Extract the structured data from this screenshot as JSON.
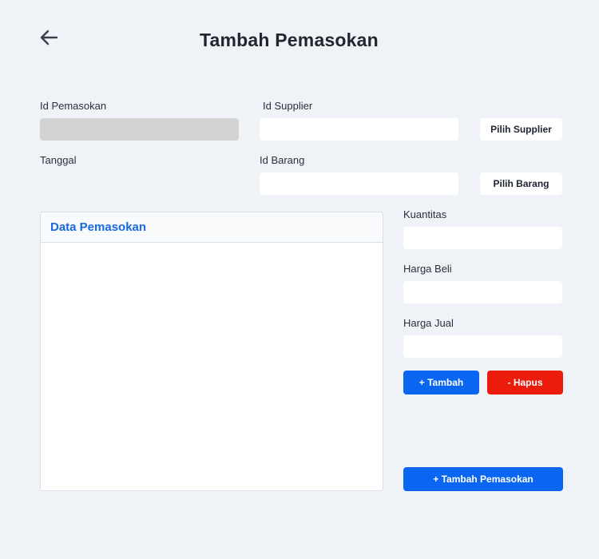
{
  "header": {
    "title": "Tambah Pemasokan",
    "back_icon": "arrow-left-icon"
  },
  "form": {
    "id_pemasokan": {
      "label": "Id Pemasokan",
      "value": ""
    },
    "id_supplier": {
      "label": "Id Supplier",
      "value": "",
      "button": "Pilih Supplier"
    },
    "tanggal": {
      "label": "Tanggal"
    },
    "id_barang": {
      "label": "Id Barang",
      "value": "",
      "button": "Pilih Barang"
    },
    "kuantitas": {
      "label": "Kuantitas",
      "value": ""
    },
    "harga_beli": {
      "label": "Harga Beli",
      "value": ""
    },
    "harga_jual": {
      "label": "Harga Jual",
      "value": ""
    }
  },
  "actions": {
    "tambah": "+ Tambah",
    "hapus": "- Hapus",
    "tambah_pemasokan": "+ Tambah Pemasokan"
  },
  "panel": {
    "title": "Data Pemasokan"
  },
  "colors": {
    "background": "#eff3f8",
    "primary": "#0a66f0",
    "danger": "#ec1c0c",
    "disabled_field": "#d3d3d3",
    "panel_title": "#1769e0"
  }
}
